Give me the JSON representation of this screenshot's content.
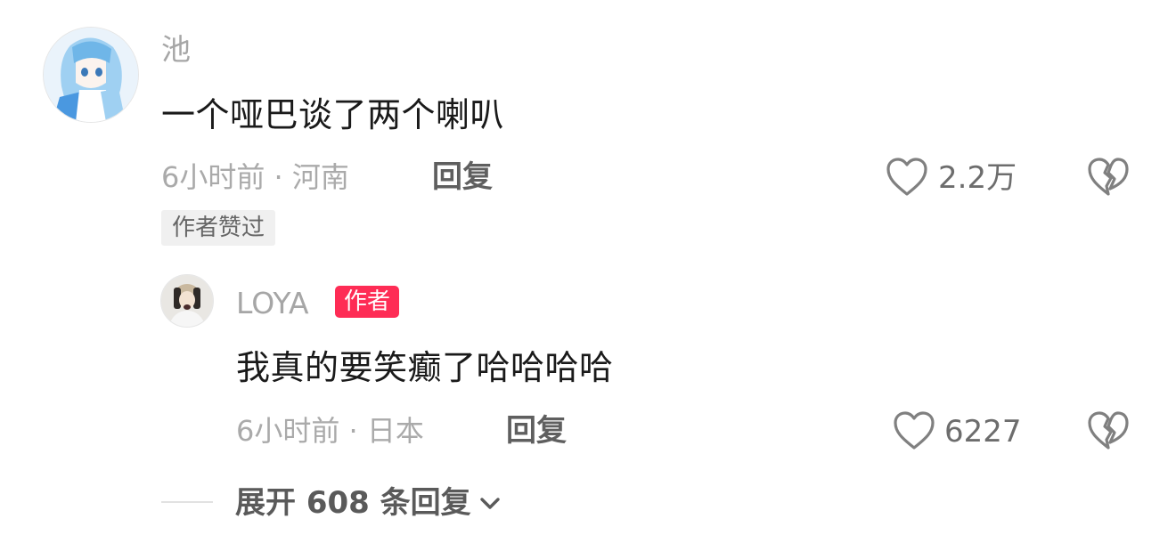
{
  "comment": {
    "username": "池",
    "text": "一个哑巴谈了两个喇叭",
    "time_location": "6小时前 · 河南",
    "reply_label": "回复",
    "likes": "2.2万",
    "author_liked_badge": "作者赞过",
    "avatar_icon": "anime-avatar-icon"
  },
  "reply": {
    "username": "LOYA",
    "author_tag": "作者",
    "text": "我真的要笑癫了哈哈哈哈",
    "time_location": "6小时前 · 日本",
    "reply_label": "回复",
    "likes": "6227",
    "avatar_icon": "photo-avatar-icon"
  },
  "expand": {
    "label": "展开 608 条回复"
  },
  "colors": {
    "author_tag_bg": "#fe2c55",
    "text_primary": "#1a1a1a",
    "text_muted": "#aaaaaa"
  }
}
